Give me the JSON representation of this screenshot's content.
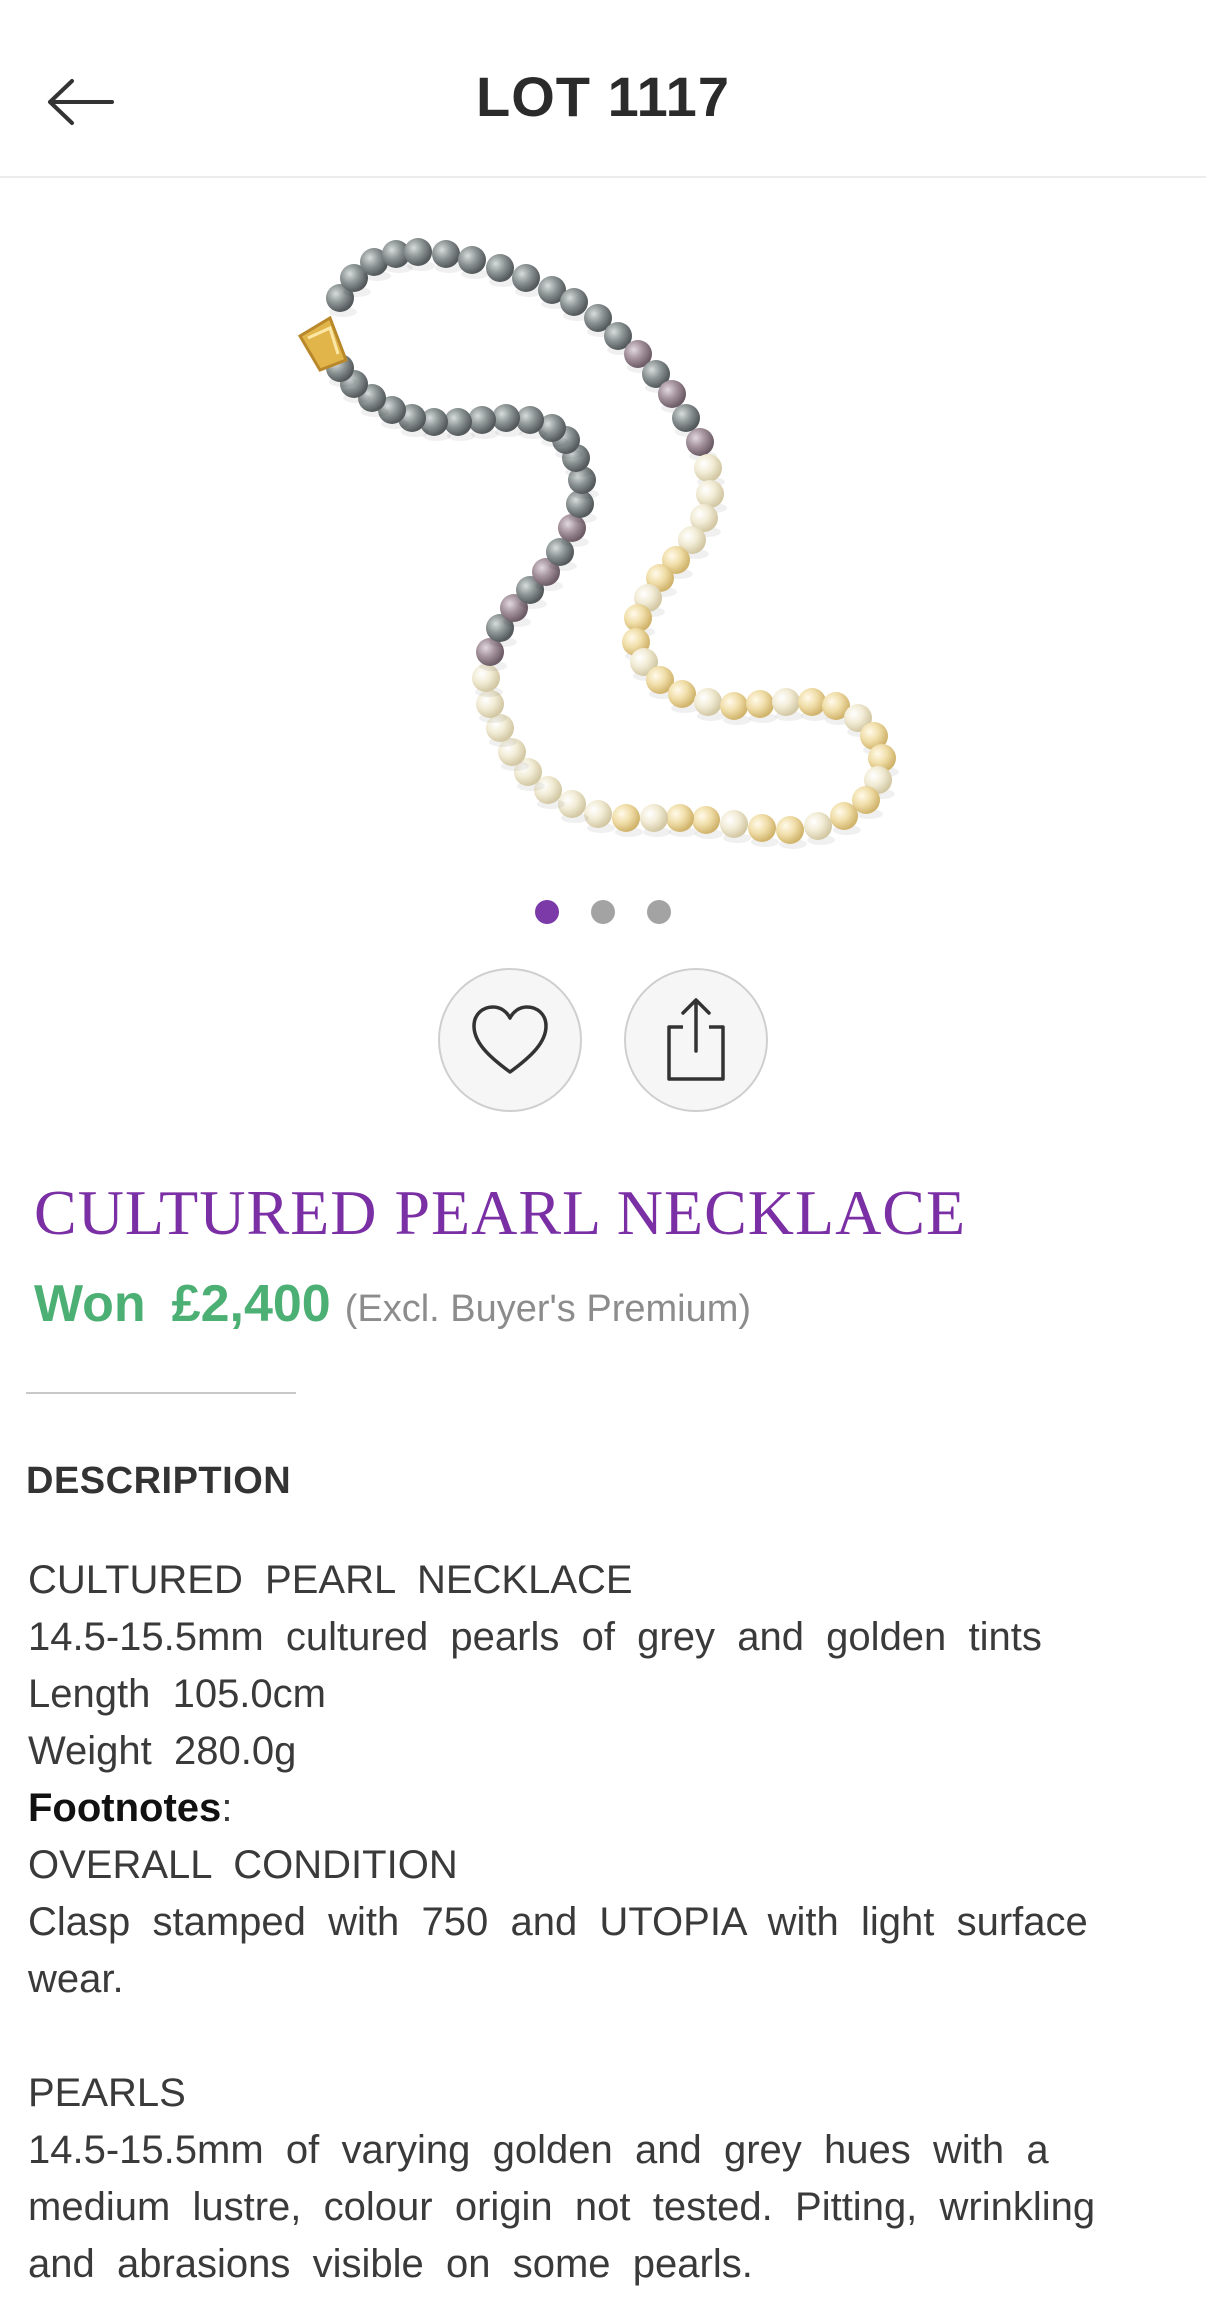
{
  "header": {
    "title": "LOT  1117",
    "back_icon": "arrow-left-icon"
  },
  "gallery": {
    "image_count": 3,
    "active_index": 0,
    "image_alt": "Cultured pearl necklace of grey and golden pearls with gold clasp"
  },
  "actions": {
    "favorite_icon": "heart-icon",
    "share_icon": "share-icon"
  },
  "lot": {
    "title": "CULTURED PEARL NECKLACE",
    "status_label": "Won",
    "price": "£2,400",
    "premium_note": "(Excl. Buyer's Premium)"
  },
  "description": {
    "heading": "DESCRIPTION",
    "lines": [
      "CULTURED  PEARL  NECKLACE",
      "14.5-15.5mm  cultured  pearls  of  grey  and  golden  tints",
      "Length  105.0cm",
      "Weight  280.0g"
    ],
    "footnotes_label": "Footnotes",
    "footnotes_colon": ":",
    "condition_heading": "OVERALL  CONDITION",
    "condition_lines": [
      "Clasp  stamped  with  750  and  UTOPIA  with  light  surface",
      "wear."
    ],
    "pearls_heading": "PEARLS",
    "pearls_lines": [
      "14.5-15.5mm  of  varying  golden  and  grey  hues  with  a",
      "medium  lustre,  colour  origin  not  tested.  Pitting,  wrinkling",
      "and  abrasions  visible  on  some  pearls."
    ]
  },
  "colors": {
    "accent_purple": "#7b2fa5",
    "won_green": "#4caf73"
  }
}
